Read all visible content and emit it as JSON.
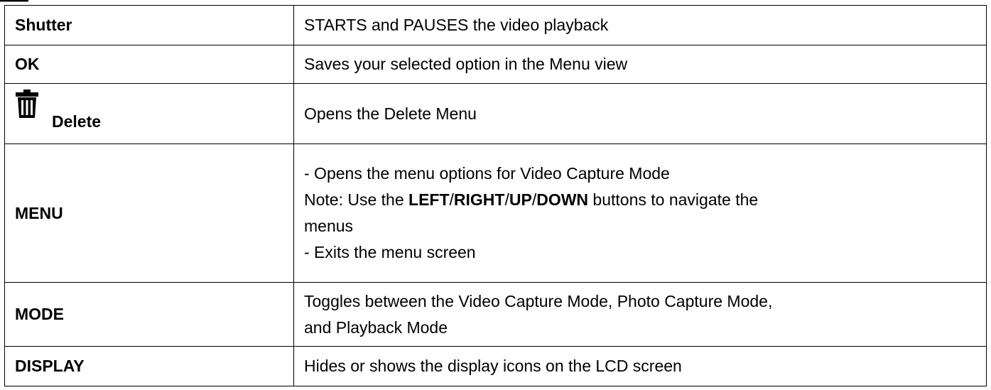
{
  "rows": [
    {
      "key": "Shutter",
      "description": "STARTS and PAUSES the video playback"
    },
    {
      "key": "OK",
      "description": "Saves your selected option in the Menu view"
    },
    {
      "key": "Delete",
      "key_icon": "trash-icon",
      "description": "Opens the Delete Menu"
    },
    {
      "key": "MENU",
      "description_line1": "- Opens the menu options for Video Capture Mode",
      "note_prefix": "Note: Use the ",
      "note_left": "LEFT",
      "slash1": "/",
      "note_right": "RIGHT",
      "slash2": "/",
      "note_up": "UP",
      "slash3": "/",
      "note_down": "DOWN",
      "note_suffix": " buttons to navigate the",
      "note_cont": "menus",
      "description_line4": "- Exits the menu screen"
    },
    {
      "key": "MODE",
      "description_line1": "Toggles between the Video Capture Mode, Photo Capture Mode,",
      "description_line2": "and Playback Mode"
    },
    {
      "key": "DISPLAY",
      "description": "Hides or shows the display icons on the LCD screen"
    }
  ]
}
